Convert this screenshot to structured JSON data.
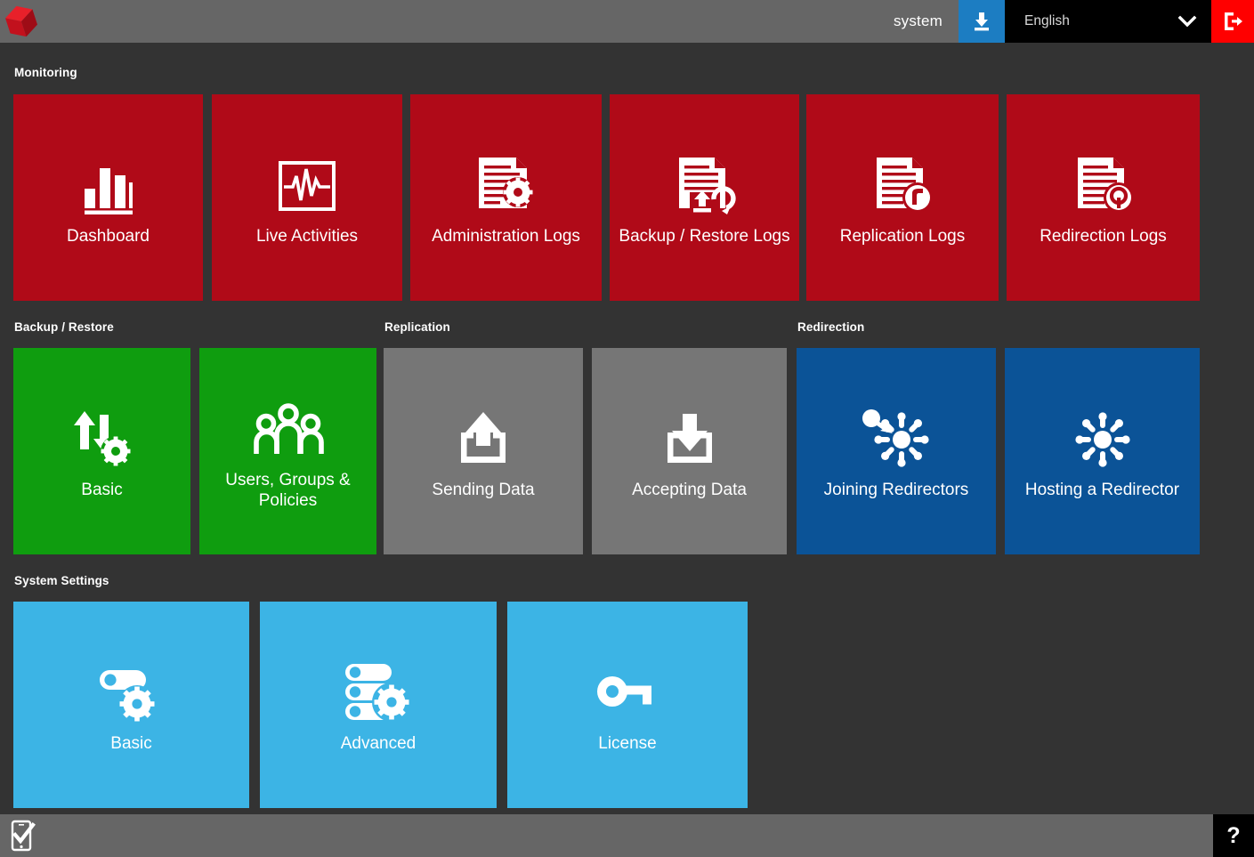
{
  "header": {
    "logo_name": "red-cube-logo",
    "user": "system",
    "download_icon": "download-icon",
    "language": "English",
    "language_chevron": "chevron-down-icon",
    "logout_icon": "logout-icon",
    "colors": {
      "bar": "#666666",
      "download_button": "#1C7DC2",
      "language_box": "#000000",
      "logout_button": "#FF0000"
    }
  },
  "sections": [
    {
      "title": "Monitoring",
      "color": "#B00A18",
      "tiles": [
        {
          "label": "Dashboard",
          "icon": "bar-chart-icon"
        },
        {
          "label": "Live Activities",
          "icon": "heartbeat-monitor-icon"
        },
        {
          "label": "Administration Logs",
          "icon": "document-gear-icon"
        },
        {
          "label": "Backup / Restore Logs",
          "icon": "document-backup-restore-icon"
        },
        {
          "label": "Replication Logs",
          "icon": "document-replication-icon"
        },
        {
          "label": "Redirection Logs",
          "icon": "document-redirection-icon"
        }
      ]
    },
    {
      "title": "Backup / Restore",
      "color": "#0F9D0F",
      "tiles": [
        {
          "label": "Basic",
          "icon": "transfer-arrows-gear-icon"
        },
        {
          "label": "Users, Groups & Policies",
          "icon": "people-group-icon"
        }
      ]
    },
    {
      "title": "Replication",
      "color": "#767676",
      "tiles": [
        {
          "label": "Sending Data",
          "icon": "upload-tray-icon"
        },
        {
          "label": "Accepting Data",
          "icon": "download-tray-icon"
        }
      ]
    },
    {
      "title": "Redirection",
      "color": "#0B5397",
      "tiles": [
        {
          "label": "Joining Redirectors",
          "icon": "node-join-hub-icon"
        },
        {
          "label": "Hosting a Redirector",
          "icon": "node-hub-icon"
        }
      ]
    },
    {
      "title": "System Settings",
      "color": "#3CB4E5",
      "tiles": [
        {
          "label": "Basic",
          "icon": "toggle-gear-icon"
        },
        {
          "label": "Advanced",
          "icon": "server-gear-icon"
        },
        {
          "label": "License",
          "icon": "key-icon"
        }
      ]
    }
  ],
  "footer": {
    "mobile_icon": "mobile-check-icon",
    "help_label": "?"
  }
}
